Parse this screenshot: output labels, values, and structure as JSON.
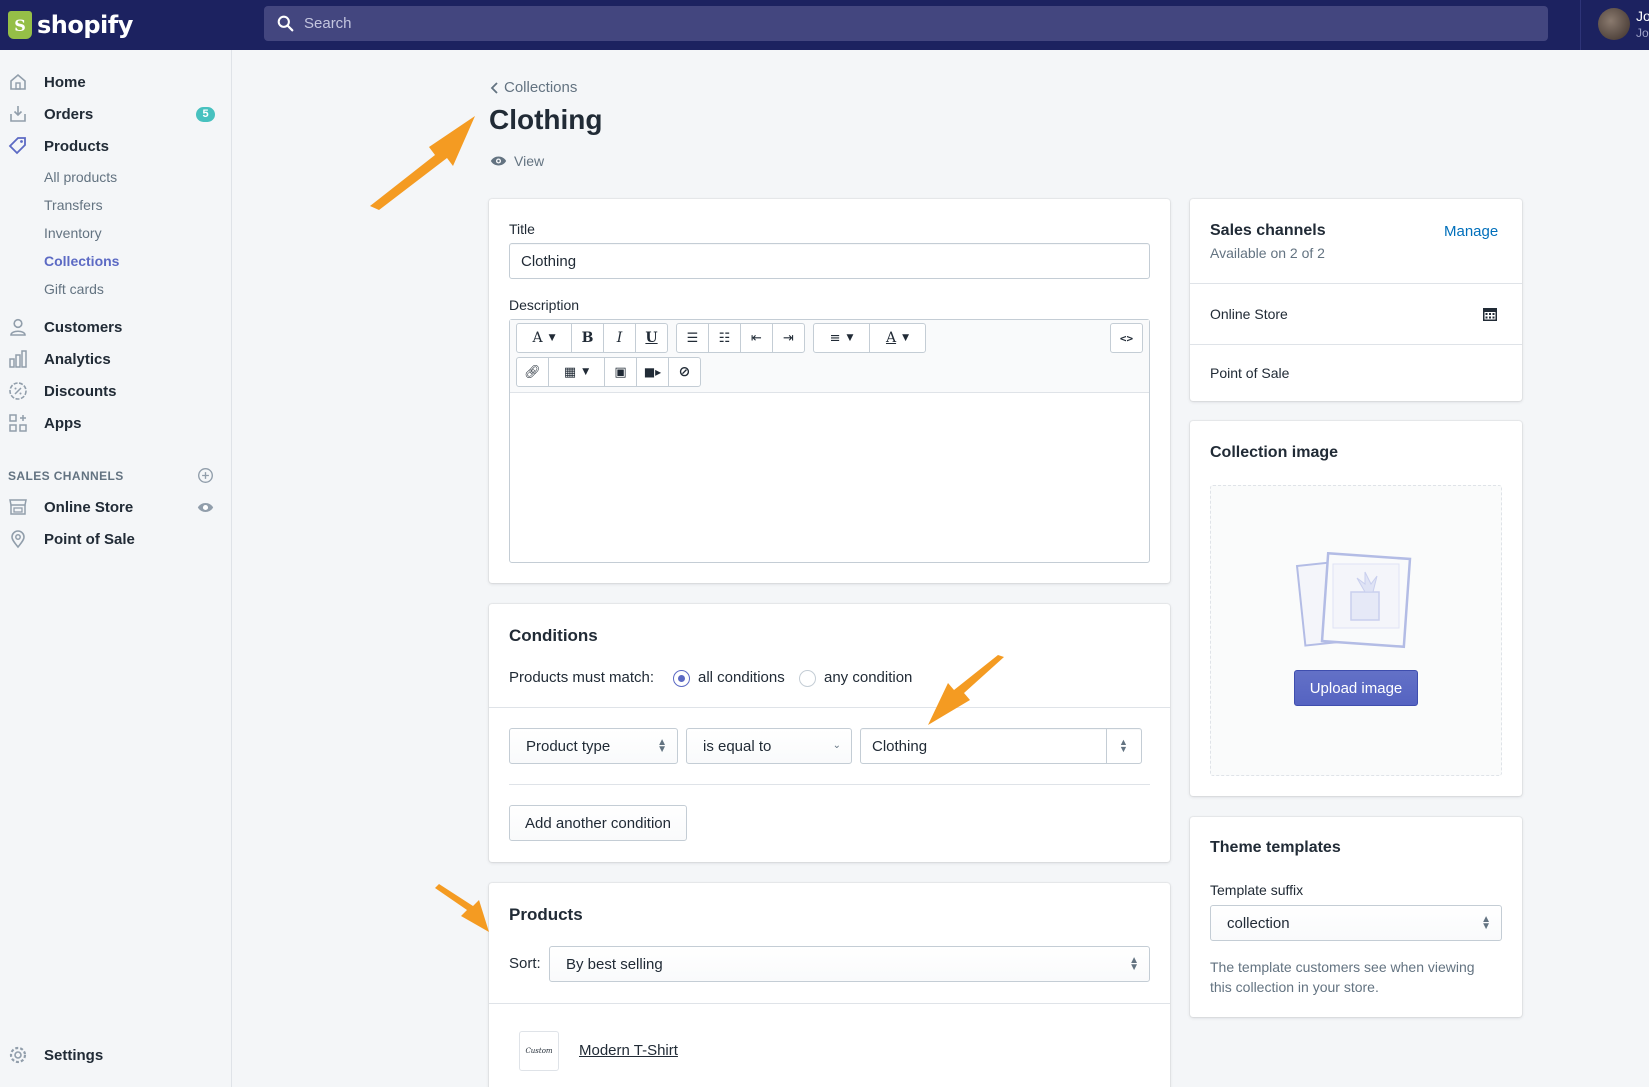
{
  "brand": {
    "name": "shopify",
    "logo_letter": "S"
  },
  "topbar": {
    "search_placeholder": "Search",
    "user_name": "Jo",
    "user_sub": "Jo"
  },
  "sidebar": {
    "items": [
      {
        "label": "Home",
        "icon": "home-icon"
      },
      {
        "label": "Orders",
        "icon": "orders-icon",
        "badge": "5"
      },
      {
        "label": "Products",
        "icon": "tag-icon"
      },
      {
        "label": "Customers",
        "icon": "person-icon"
      },
      {
        "label": "Analytics",
        "icon": "bar-chart-icon"
      },
      {
        "label": "Discounts",
        "icon": "discount-icon"
      },
      {
        "label": "Apps",
        "icon": "apps-icon"
      }
    ],
    "product_subitems": [
      "All products",
      "Transfers",
      "Inventory",
      "Collections",
      "Gift cards"
    ],
    "active_subitem": "Collections",
    "channels_title": "SALES CHANNELS",
    "channels": [
      {
        "label": "Online Store",
        "icon": "store-icon"
      },
      {
        "label": "Point of Sale",
        "icon": "location-icon"
      }
    ],
    "settings": "Settings"
  },
  "page": {
    "breadcrumb": "Collections",
    "title": "Clothing",
    "view_label": "View"
  },
  "details": {
    "title_label": "Title",
    "title_value": "Clothing",
    "description_label": "Description",
    "html_toggle": "<>"
  },
  "conditions": {
    "heading": "Conditions",
    "match_label": "Products must match:",
    "option_all": "all conditions",
    "option_any": "any condition",
    "selected": "all conditions",
    "field": "Product type",
    "operator": "is equal to",
    "value": "Clothing",
    "add_button": "Add another condition"
  },
  "products": {
    "heading": "Products",
    "sort_label": "Sort:",
    "sort_value": "By best selling",
    "items": [
      {
        "name": "Modern T-Shirt",
        "thumb_text": "Custom"
      }
    ]
  },
  "sales_channels": {
    "heading": "Sales channels",
    "subtitle": "Available on 2 of 2",
    "manage": "Manage",
    "channels": [
      "Online Store",
      "Point of Sale"
    ]
  },
  "collection_image": {
    "heading": "Collection image",
    "upload_button": "Upload image"
  },
  "theme_templates": {
    "heading": "Theme templates",
    "suffix_label": "Template suffix",
    "suffix_value": "collection",
    "help_text_line1": "The template customers see when viewing",
    "help_text_line2": "this collection in your store."
  },
  "colors": {
    "topbar": "#1c2260",
    "accent": "#5c6ac4",
    "annotation": "#f49b22",
    "link": "#006fbb"
  }
}
